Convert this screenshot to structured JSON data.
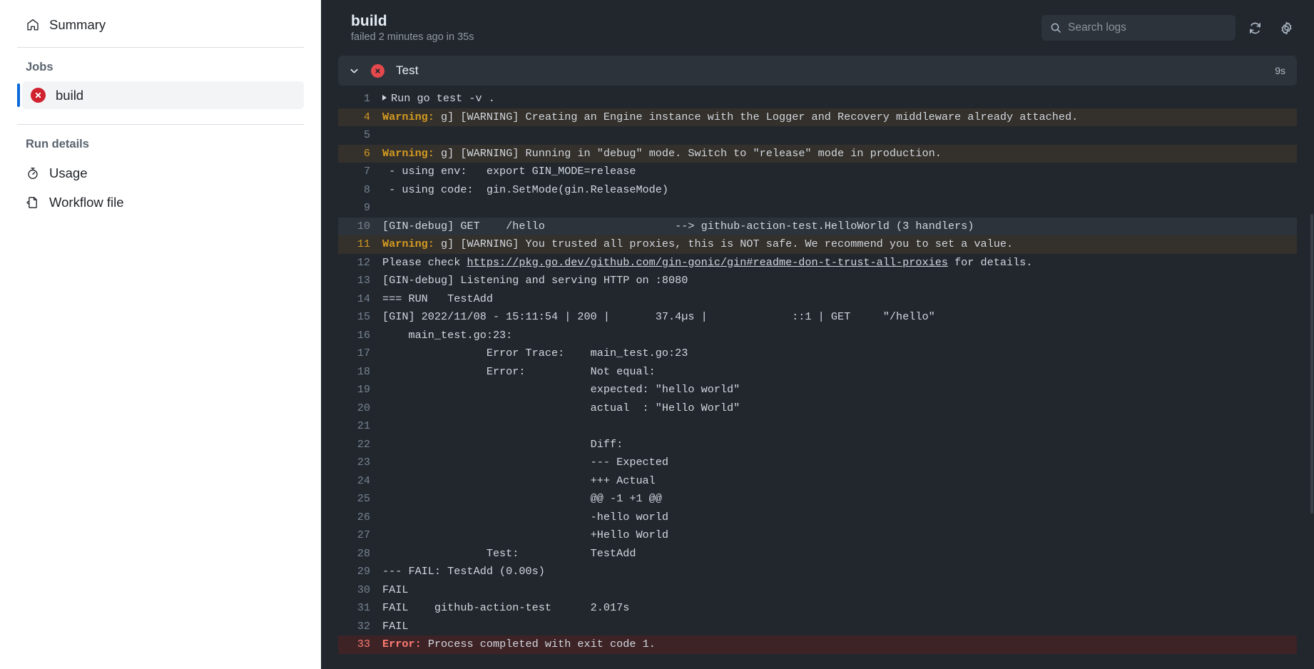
{
  "sidebar": {
    "summary": {
      "label": "Summary",
      "icon": "home-icon"
    },
    "jobs_heading": "Jobs",
    "job": {
      "label": "build",
      "status": "failed",
      "icon": "x-circle-icon"
    },
    "run_details_heading": "Run details",
    "usage": {
      "label": "Usage",
      "icon": "stopwatch-icon"
    },
    "workflow_file": {
      "label": "Workflow file",
      "icon": "file-code-icon"
    }
  },
  "header": {
    "title": "build",
    "subtitle": "failed 2 minutes ago in 35s",
    "search": {
      "placeholder": "Search logs",
      "value": "",
      "icon": "search-icon"
    },
    "refresh": {
      "icon": "sync-icon",
      "tooltip": "Refresh"
    },
    "settings": {
      "icon": "gear-icon",
      "tooltip": "Settings"
    }
  },
  "step": {
    "name": "Test",
    "duration": "9s",
    "status": "failed",
    "expanded": true,
    "chevron_icon": "chevron-down-icon",
    "status_icon": "x-circle-icon"
  },
  "log": {
    "lines": [
      {
        "n": "1",
        "text": "Run go test -v .",
        "style": "normal",
        "arrow": true
      },
      {
        "n": "4",
        "text": "[WARNING] Creating an Engine instance with the Logger and Recovery middleware already attached.",
        "style": "warn",
        "prefix": "Warning:",
        "sep": " g] "
      },
      {
        "n": "5",
        "text": "",
        "style": "normal"
      },
      {
        "n": "6",
        "text": "[WARNING] Running in \"debug\" mode. Switch to \"release\" mode in production.",
        "style": "warn",
        "prefix": "Warning:",
        "sep": " g] "
      },
      {
        "n": "7",
        "text": " - using env:   export GIN_MODE=release",
        "style": "normal"
      },
      {
        "n": "8",
        "text": " - using code:  gin.SetMode(gin.ReleaseMode)",
        "style": "normal"
      },
      {
        "n": "9",
        "text": "",
        "style": "normal"
      },
      {
        "n": "10",
        "text": "[GIN-debug] GET    /hello                    --> github-action-test.HelloWorld (3 handlers)",
        "style": "hl"
      },
      {
        "n": "11",
        "text": "[WARNING] You trusted all proxies, this is NOT safe. We recommend you to set a value.",
        "style": "warn",
        "prefix": "Warning:",
        "sep": " g] "
      },
      {
        "n": "12",
        "text": "Please check ",
        "style": "link",
        "link_text": "https://pkg.go.dev/github.com/gin-gonic/gin#readme-don-t-trust-all-proxies",
        "text_after": " for details."
      },
      {
        "n": "13",
        "text": "[GIN-debug] Listening and serving HTTP on :8080",
        "style": "normal"
      },
      {
        "n": "14",
        "text": "=== RUN   TestAdd",
        "style": "normal"
      },
      {
        "n": "15",
        "text": "[GIN] 2022/11/08 - 15:11:54 | 200 |       37.4µs |             ::1 | GET     \"/hello\"",
        "style": "normal"
      },
      {
        "n": "16",
        "text": "    main_test.go:23: ",
        "style": "normal"
      },
      {
        "n": "17",
        "text": "                Error Trace:    main_test.go:23",
        "style": "normal"
      },
      {
        "n": "18",
        "text": "                Error:          Not equal: ",
        "style": "normal"
      },
      {
        "n": "19",
        "text": "                                expected: \"hello world\"",
        "style": "normal"
      },
      {
        "n": "20",
        "text": "                                actual  : \"Hello World\"",
        "style": "normal"
      },
      {
        "n": "21",
        "text": "",
        "style": "normal"
      },
      {
        "n": "22",
        "text": "                                Diff:",
        "style": "normal"
      },
      {
        "n": "23",
        "text": "                                --- Expected",
        "style": "normal"
      },
      {
        "n": "24",
        "text": "                                +++ Actual",
        "style": "normal"
      },
      {
        "n": "25",
        "text": "                                @@ -1 +1 @@",
        "style": "normal"
      },
      {
        "n": "26",
        "text": "                                -hello world",
        "style": "normal"
      },
      {
        "n": "27",
        "text": "                                +Hello World",
        "style": "normal"
      },
      {
        "n": "28",
        "text": "                Test:           TestAdd",
        "style": "normal"
      },
      {
        "n": "29",
        "text": "--- FAIL: TestAdd (0.00s)",
        "style": "normal"
      },
      {
        "n": "30",
        "text": "FAIL",
        "style": "normal"
      },
      {
        "n": "31",
        "text": "FAIL    github-action-test      2.017s",
        "style": "normal"
      },
      {
        "n": "32",
        "text": "FAIL",
        "style": "normal"
      },
      {
        "n": "33",
        "text": "Process completed with exit code 1.",
        "style": "error",
        "prefix": "Error:",
        "sep": " "
      }
    ]
  },
  "colors": {
    "panel_bg": "#22272e",
    "row_alt": "#2d333b",
    "warn_bg": "#34302b",
    "warn_fg": "#d29922",
    "error_bg": "#3d2326",
    "error_fg": "#ff7b72",
    "accent_blue": "#0969da",
    "fail_red": "#cf222e",
    "text": "#d1d7de"
  }
}
